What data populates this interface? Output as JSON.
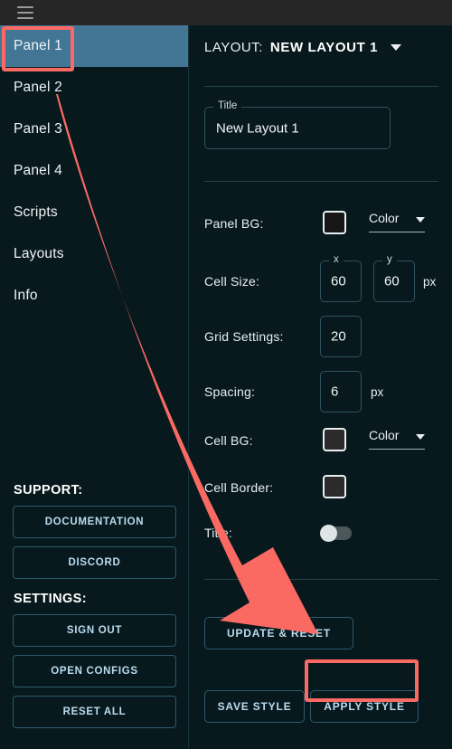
{
  "topbar": {
    "menu_icon": "hamburger-icon"
  },
  "sidebar": {
    "items": [
      {
        "label": "Panel 1",
        "active": true
      },
      {
        "label": "Panel 2",
        "active": false
      },
      {
        "label": "Panel 3",
        "active": false
      },
      {
        "label": "Panel 4",
        "active": false
      },
      {
        "label": "Scripts",
        "active": false
      },
      {
        "label": "Layouts",
        "active": false
      },
      {
        "label": "Info",
        "active": false
      }
    ],
    "support_heading": "SUPPORT:",
    "support_buttons": [
      {
        "label": "DOCUMENTATION"
      },
      {
        "label": "DISCORD"
      }
    ],
    "settings_heading": "SETTINGS:",
    "settings_buttons": [
      {
        "label": "SIGN OUT"
      },
      {
        "label": "OPEN CONFIGS"
      },
      {
        "label": "RESET ALL"
      }
    ]
  },
  "panel": {
    "layout_label": "LAYOUT:",
    "layout_value": "NEW LAYOUT 1",
    "layout_caret": "chevron-down-icon",
    "title_field": {
      "legend": "Title",
      "value": "New Layout 1"
    },
    "panel_bg": {
      "label": "Panel BG:",
      "swatch_color": "#171717",
      "select_value": "Color",
      "select_caret": "chevron-down-icon"
    },
    "cell_size": {
      "label": "Cell Size:",
      "x_legend": "x",
      "x_value": "60",
      "y_legend": "y",
      "y_value": "60",
      "unit": "px"
    },
    "grid_settings": {
      "label": "Grid Settings:",
      "value": "20"
    },
    "spacing": {
      "label": "Spacing:",
      "value": "6",
      "unit": "px"
    },
    "cell_bg": {
      "label": "Cell BG:",
      "swatch_color": "#2b2b2b",
      "select_value": "Color",
      "select_caret": "chevron-down-icon"
    },
    "cell_border": {
      "label": "Cell Border:",
      "swatch_color": "#2b2b2b"
    },
    "title_toggle": {
      "label": "Title:",
      "state": "off"
    },
    "update_reset_button": "UPDATE & RESET",
    "save_style_button": "SAVE STYLE",
    "apply_style_button": "APPLY STYLE"
  },
  "annotations": {
    "color": "#fa6a63",
    "highlight_panel1": "Panel 1",
    "highlight_apply": "APPLY STYLE",
    "arrow": "curved-arrow-icon"
  },
  "colors": {
    "background": "#08191e",
    "topbar": "#262626",
    "active_nav": "#437695",
    "accent_button_text": "#b9dcef",
    "annotation": "#fa6a63"
  }
}
